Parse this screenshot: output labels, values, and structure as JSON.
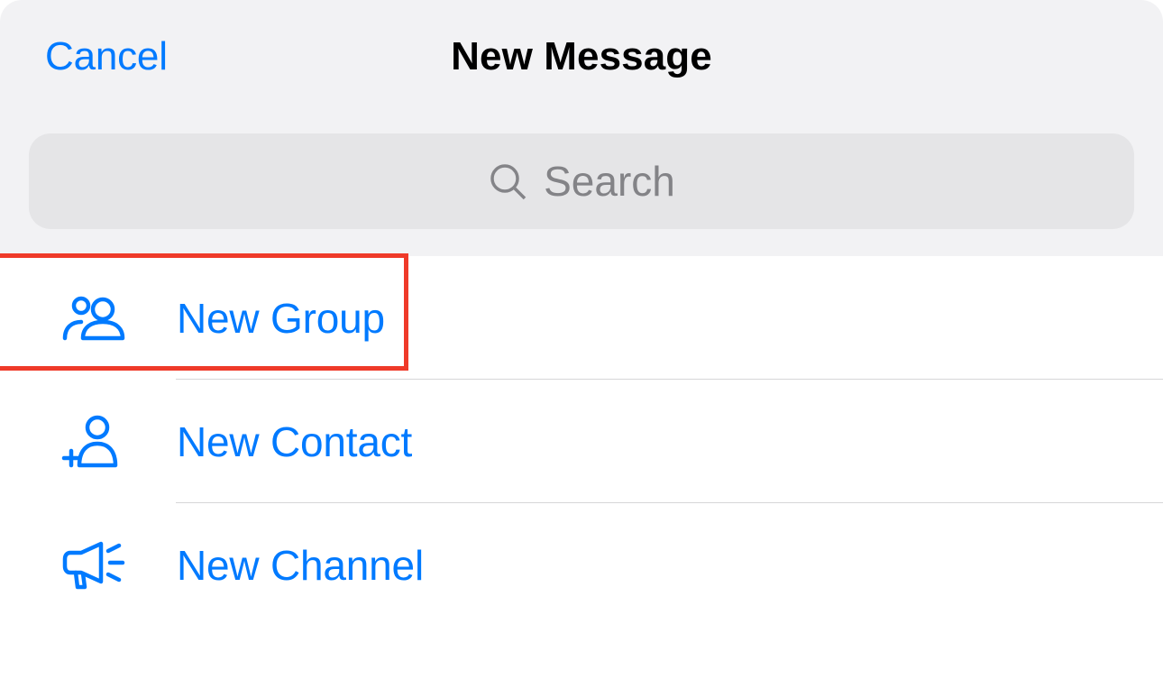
{
  "header": {
    "cancel_label": "Cancel",
    "title": "New Message"
  },
  "search": {
    "placeholder": "Search"
  },
  "options": {
    "new_group": "New Group",
    "new_contact": "New Contact",
    "new_channel": "New Channel"
  },
  "colors": {
    "accent": "#007aff",
    "highlight": "#ef3a29"
  }
}
